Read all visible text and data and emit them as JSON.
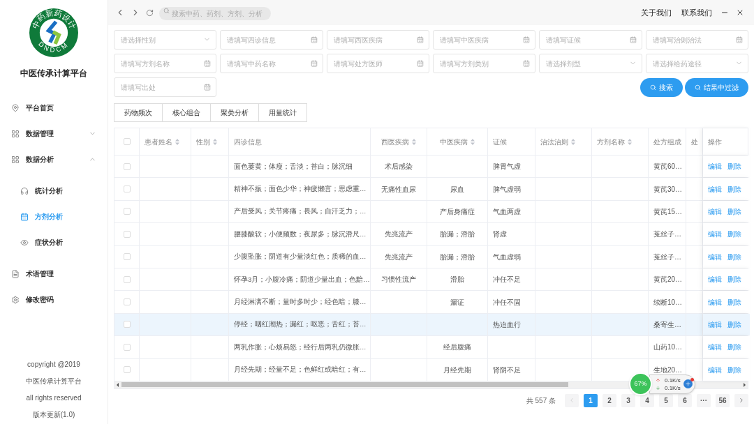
{
  "logo": {
    "top_text": "中药新药设计",
    "bottom_text": "DNDCM"
  },
  "app_title": "中医传承计算平台",
  "sidebar": {
    "items": [
      {
        "label": "平台首页",
        "selected": false
      },
      {
        "label": "数据管理",
        "selected": false,
        "expanded": false
      },
      {
        "label": "数据分析",
        "selected": false,
        "expanded": true,
        "children": [
          {
            "label": "统计分析",
            "selected": false
          },
          {
            "label": "方剂分析",
            "selected": true
          },
          {
            "label": "症状分析",
            "selected": false
          }
        ]
      },
      {
        "label": "术语管理",
        "selected": false
      },
      {
        "label": "修改密码",
        "selected": false
      }
    ]
  },
  "footer": [
    "copyright @2019",
    "中医传承计算平台",
    "all rights reserved",
    "版本更新(1.0)"
  ],
  "topbar": {
    "search_placeholder": "搜索中药、药剂、方剂、分析",
    "links": [
      "关于我们",
      "联系我们"
    ]
  },
  "filters": [
    {
      "kind": "select",
      "placeholder": "请选择性别"
    },
    {
      "kind": "input",
      "placeholder": "请填写四诊信息"
    },
    {
      "kind": "input",
      "placeholder": "请填写西医疾病"
    },
    {
      "kind": "input",
      "placeholder": "请填写中医疾病"
    },
    {
      "kind": "input",
      "placeholder": "请填写证候"
    },
    {
      "kind": "input",
      "placeholder": "请填写治则治法"
    },
    {
      "kind": "input",
      "placeholder": "请填写方剂名称"
    },
    {
      "kind": "input",
      "placeholder": "请填写中药名称"
    },
    {
      "kind": "input",
      "placeholder": "请填写处方医师"
    },
    {
      "kind": "input",
      "placeholder": "请填写方剂类别"
    },
    {
      "kind": "select",
      "placeholder": "请选择剂型"
    },
    {
      "kind": "select",
      "placeholder": "请选择给药途径"
    },
    {
      "kind": "input",
      "placeholder": "请填写出处"
    }
  ],
  "buttons": [
    "搜索",
    "结果中过滤"
  ],
  "tabs": [
    {
      "label": "药物频次",
      "selected": false
    },
    {
      "label": "核心组合",
      "selected": false
    },
    {
      "label": "聚类分析",
      "selected": false
    },
    {
      "label": "用量统计",
      "selected": false
    }
  ],
  "table": {
    "select_all_checked": false,
    "columns": [
      {
        "label": "患者姓名",
        "sortable": true
      },
      {
        "label": "性别",
        "sortable": true
      },
      {
        "label": "四诊信息",
        "sortable": false
      },
      {
        "label": "西医疾病",
        "sortable": true
      },
      {
        "label": "中医疾病",
        "sortable": true
      },
      {
        "label": "证候",
        "sortable": false
      },
      {
        "label": "治法治则",
        "sortable": true
      },
      {
        "label": "方剂名称",
        "sortable": true
      },
      {
        "label": "处方组成",
        "sortable": false
      },
      {
        "label": "处",
        "sortable": false
      },
      {
        "label": "操作",
        "sortable": false
      }
    ],
    "rows": [
      {
        "checked": false,
        "highlighted": false,
        "diagnosis": "面色萎黄；体瘦；舌淡；苔白；脉沉细",
        "western_disease": "术后感染",
        "syndrome": "脾胃气虚",
        "prescription": "黄芪60…",
        "actions": [
          "编辑",
          "删除"
        ]
      },
      {
        "checked": false,
        "highlighted": false,
        "diagnosis": "精神不振；面色少华；神疲懒言；思虑重…",
        "western_disease": "无痛性血尿",
        "tcm_disease": "尿血",
        "syndrome": "脾气虚弱",
        "prescription": "黄芪30…",
        "actions": [
          "编辑",
          "删除"
        ]
      },
      {
        "checked": false,
        "highlighted": false,
        "diagnosis": "产后受风；关节疼痛；畏风；自汗乏力；…",
        "tcm_disease": "产后身痛症",
        "syndrome": "气血两虚",
        "prescription": "黄芪15…",
        "actions": [
          "编辑",
          "删除"
        ]
      },
      {
        "checked": false,
        "highlighted": false,
        "diagnosis": "腰膝酸软；小便频数；夜尿多；脉沉滑尺…",
        "western_disease": "先兆流产",
        "tcm_disease": "胎漏；滑胎",
        "syndrome": "肾虚",
        "prescription": "菟丝子…",
        "actions": [
          "编辑",
          "删除"
        ]
      },
      {
        "checked": false,
        "highlighted": false,
        "diagnosis": "少腹坠胀；阴道有少量淡红色；质稀的血…",
        "western_disease": "先兆流产",
        "tcm_disease": "胎漏；滑胎",
        "syndrome": "气血虚弱",
        "prescription": "菟丝子…",
        "actions": [
          "编辑",
          "删除"
        ]
      },
      {
        "checked": false,
        "highlighted": false,
        "diagnosis": "怀孕3月；小腹冷痛；阴道少量出血；色黯…",
        "western_disease": "习惯性流产",
        "tcm_disease": "滑胎",
        "syndrome": "冲任不足",
        "prescription": "黄芪20…",
        "actions": [
          "编辑",
          "删除"
        ]
      },
      {
        "checked": false,
        "highlighted": false,
        "diagnosis": "月经淋漓不断；量时多时少；经色暗；膝…",
        "tcm_disease": "漏证",
        "syndrome": "冲任不固",
        "prescription": "续断10…",
        "actions": [
          "编辑",
          "删除"
        ]
      },
      {
        "checked": false,
        "highlighted": true,
        "diagnosis": "停经；咽红潮热；漏红；呕恶；舌红；苔…",
        "syndrome": "热迫血行",
        "prescription": "桑寄生…",
        "actions": [
          "编辑",
          "删除"
        ]
      },
      {
        "checked": false,
        "highlighted": false,
        "diagnosis": "两乳作胀；心烦易怒；经行后两乳仍微胀…",
        "tcm_disease": "经后腹痛",
        "prescription": "山药10…",
        "actions": [
          "编辑",
          "删除"
        ]
      },
      {
        "checked": false,
        "highlighted": false,
        "diagnosis": "月经先期；经量不足；色鲜红或暗红；有…",
        "tcm_disease": "月经先期",
        "syndrome": "肾阴不足",
        "prescription": "生地20…",
        "actions": [
          "编辑",
          "删除"
        ]
      }
    ]
  },
  "pagination": {
    "total": "共 557 条",
    "pages": [
      {
        "label": "1",
        "selected": true
      },
      {
        "label": "2",
        "selected": false
      },
      {
        "label": "3",
        "selected": false
      },
      {
        "label": "4",
        "selected": false
      },
      {
        "label": "5",
        "selected": false
      },
      {
        "label": "6",
        "selected": false
      },
      {
        "label": "···",
        "selected": false
      },
      {
        "label": "56",
        "selected": false
      }
    ]
  },
  "net_widget": {
    "percent": "67%",
    "upload": "0.1K/s",
    "download": "0.1K/s"
  }
}
